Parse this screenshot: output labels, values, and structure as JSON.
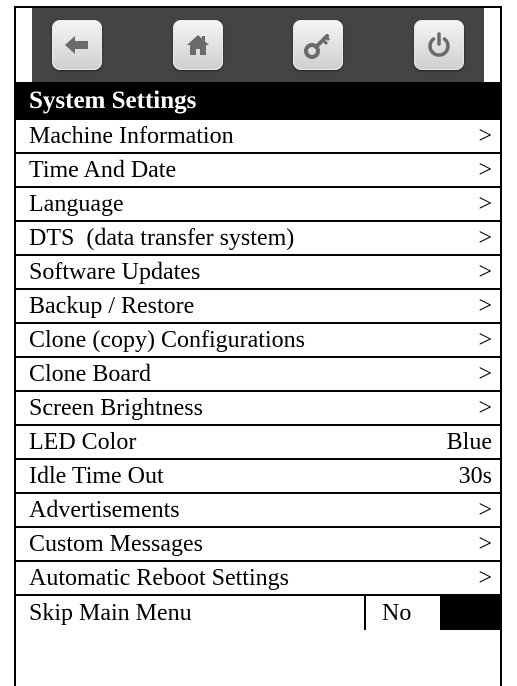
{
  "toolbar": {
    "buttons": [
      {
        "icon": "arrow-left-icon",
        "label": "back"
      },
      {
        "icon": "home-icon",
        "label": "home"
      },
      {
        "icon": "key-icon",
        "label": "key"
      },
      {
        "icon": "power-icon",
        "label": "power"
      }
    ],
    "background_color": "#444444"
  },
  "header": {
    "title": "System Settings"
  },
  "menu": {
    "items": [
      {
        "label": "Machine Information",
        "value": ">"
      },
      {
        "label": "Time And Date",
        "value": ">"
      },
      {
        "label": "Language",
        "value": ">"
      },
      {
        "label": "DTS  (data transfer system)",
        "value": ">"
      },
      {
        "label": "Software Updates",
        "value": ">"
      },
      {
        "label": "Backup / Restore",
        "value": ">"
      },
      {
        "label": "Clone (copy) Configurations",
        "value": ">"
      },
      {
        "label": "Clone Board",
        "value": ">"
      },
      {
        "label": "Screen Brightness",
        "value": ">"
      },
      {
        "label": "LED Color",
        "value": "Blue"
      },
      {
        "label": "Idle Time Out",
        "value": "30s"
      },
      {
        "label": "Advertisements",
        "value": ">"
      },
      {
        "label": "Custom Messages",
        "value": ">"
      },
      {
        "label": "Automatic Reboot Settings",
        "value": ">"
      }
    ],
    "skip": {
      "label": "Skip Main Menu",
      "value": "No"
    }
  }
}
